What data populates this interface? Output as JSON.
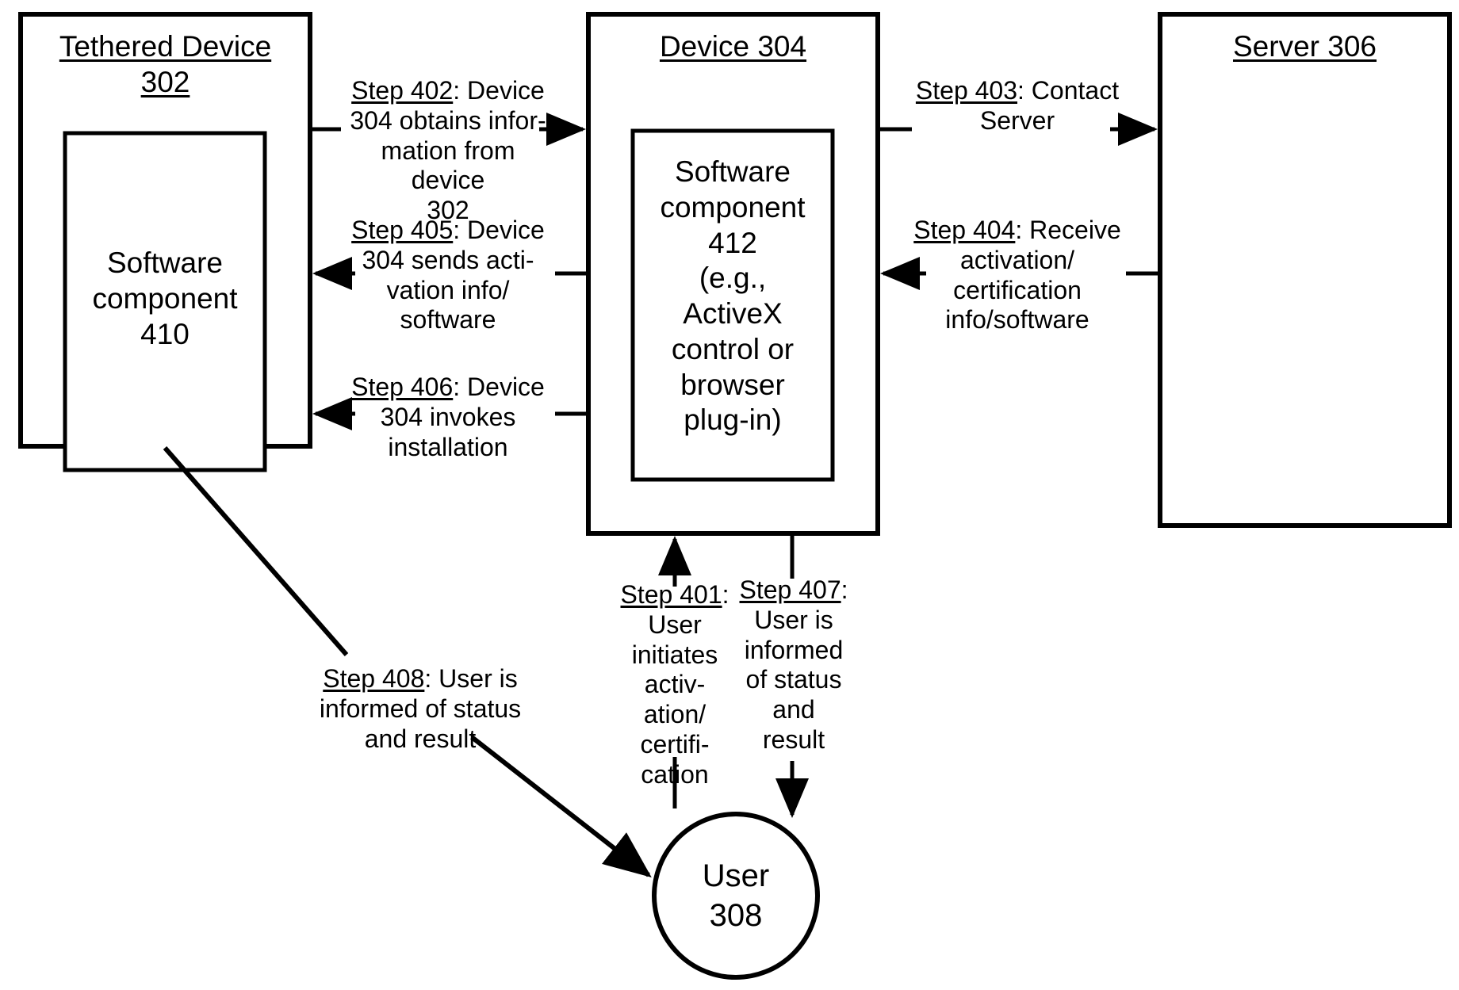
{
  "diagram": {
    "type": "patent-flow-diagram",
    "nodes": [
      {
        "id": "tethered-device-302",
        "title": "Tethered Device\n302",
        "inner": "Software\ncomponent\n410"
      },
      {
        "id": "device-304",
        "title": "Device 304",
        "inner": "Software\ncomponent\n412\n(e.g.,\nActiveX\ncontrol or\nbrowser\nplug-in)"
      },
      {
        "id": "server-306",
        "title": "Server 306",
        "inner": ""
      },
      {
        "id": "user-308",
        "title": "User\n308",
        "inner": ""
      }
    ],
    "steps": [
      {
        "id": "step-402",
        "number": "Step 402",
        "text": ": Device 304 obtains infor-mation from device 302",
        "line1": "Step 402",
        "rest": ": Device",
        "lines": [
          "304 obtains infor-",
          "mation from device",
          "302"
        ],
        "from": "tethered-device-302",
        "to": "device-304",
        "direction": "right"
      },
      {
        "id": "step-405",
        "number": "Step 405",
        "rest": ": Device",
        "lines": [
          "304 sends acti-",
          "vation info/",
          "software"
        ],
        "from": "device-304",
        "to": "tethered-device-302",
        "direction": "left"
      },
      {
        "id": "step-406",
        "number": "Step 406",
        "rest": ": Device",
        "lines": [
          "304 invokes",
          "installation"
        ],
        "from": "device-304",
        "to": "tethered-device-302",
        "direction": "left"
      },
      {
        "id": "step-403",
        "number": "Step 403",
        "rest": ": Contact",
        "lines": [
          "Server"
        ],
        "from": "device-304",
        "to": "server-306",
        "direction": "right"
      },
      {
        "id": "step-404",
        "number": "Step 404",
        "rest": ": Receive",
        "lines": [
          "activation/",
          "certification",
          "info/software"
        ],
        "from": "server-306",
        "to": "device-304",
        "direction": "left"
      },
      {
        "id": "step-401",
        "number": "Step 401",
        "rest": ":",
        "lines": [
          "User",
          "initiates",
          "activ-",
          "ation/",
          "certifi-",
          "cation"
        ],
        "from": "user-308",
        "to": "device-304",
        "direction": "up"
      },
      {
        "id": "step-407",
        "number": "Step 407",
        "rest": ":",
        "lines": [
          "User is",
          "informed",
          "of status",
          "and",
          "result"
        ],
        "from": "device-304",
        "to": "user-308",
        "direction": "down"
      },
      {
        "id": "step-408",
        "number": "Step 408",
        "rest": ": User is",
        "lines": [
          "informed of status",
          "and result"
        ],
        "from": "tethered-device-302",
        "to": "user-308",
        "direction": "diagonal-down-right"
      }
    ]
  },
  "colors": {
    "stroke": "#000000",
    "background": "#ffffff",
    "text": "#000000"
  }
}
